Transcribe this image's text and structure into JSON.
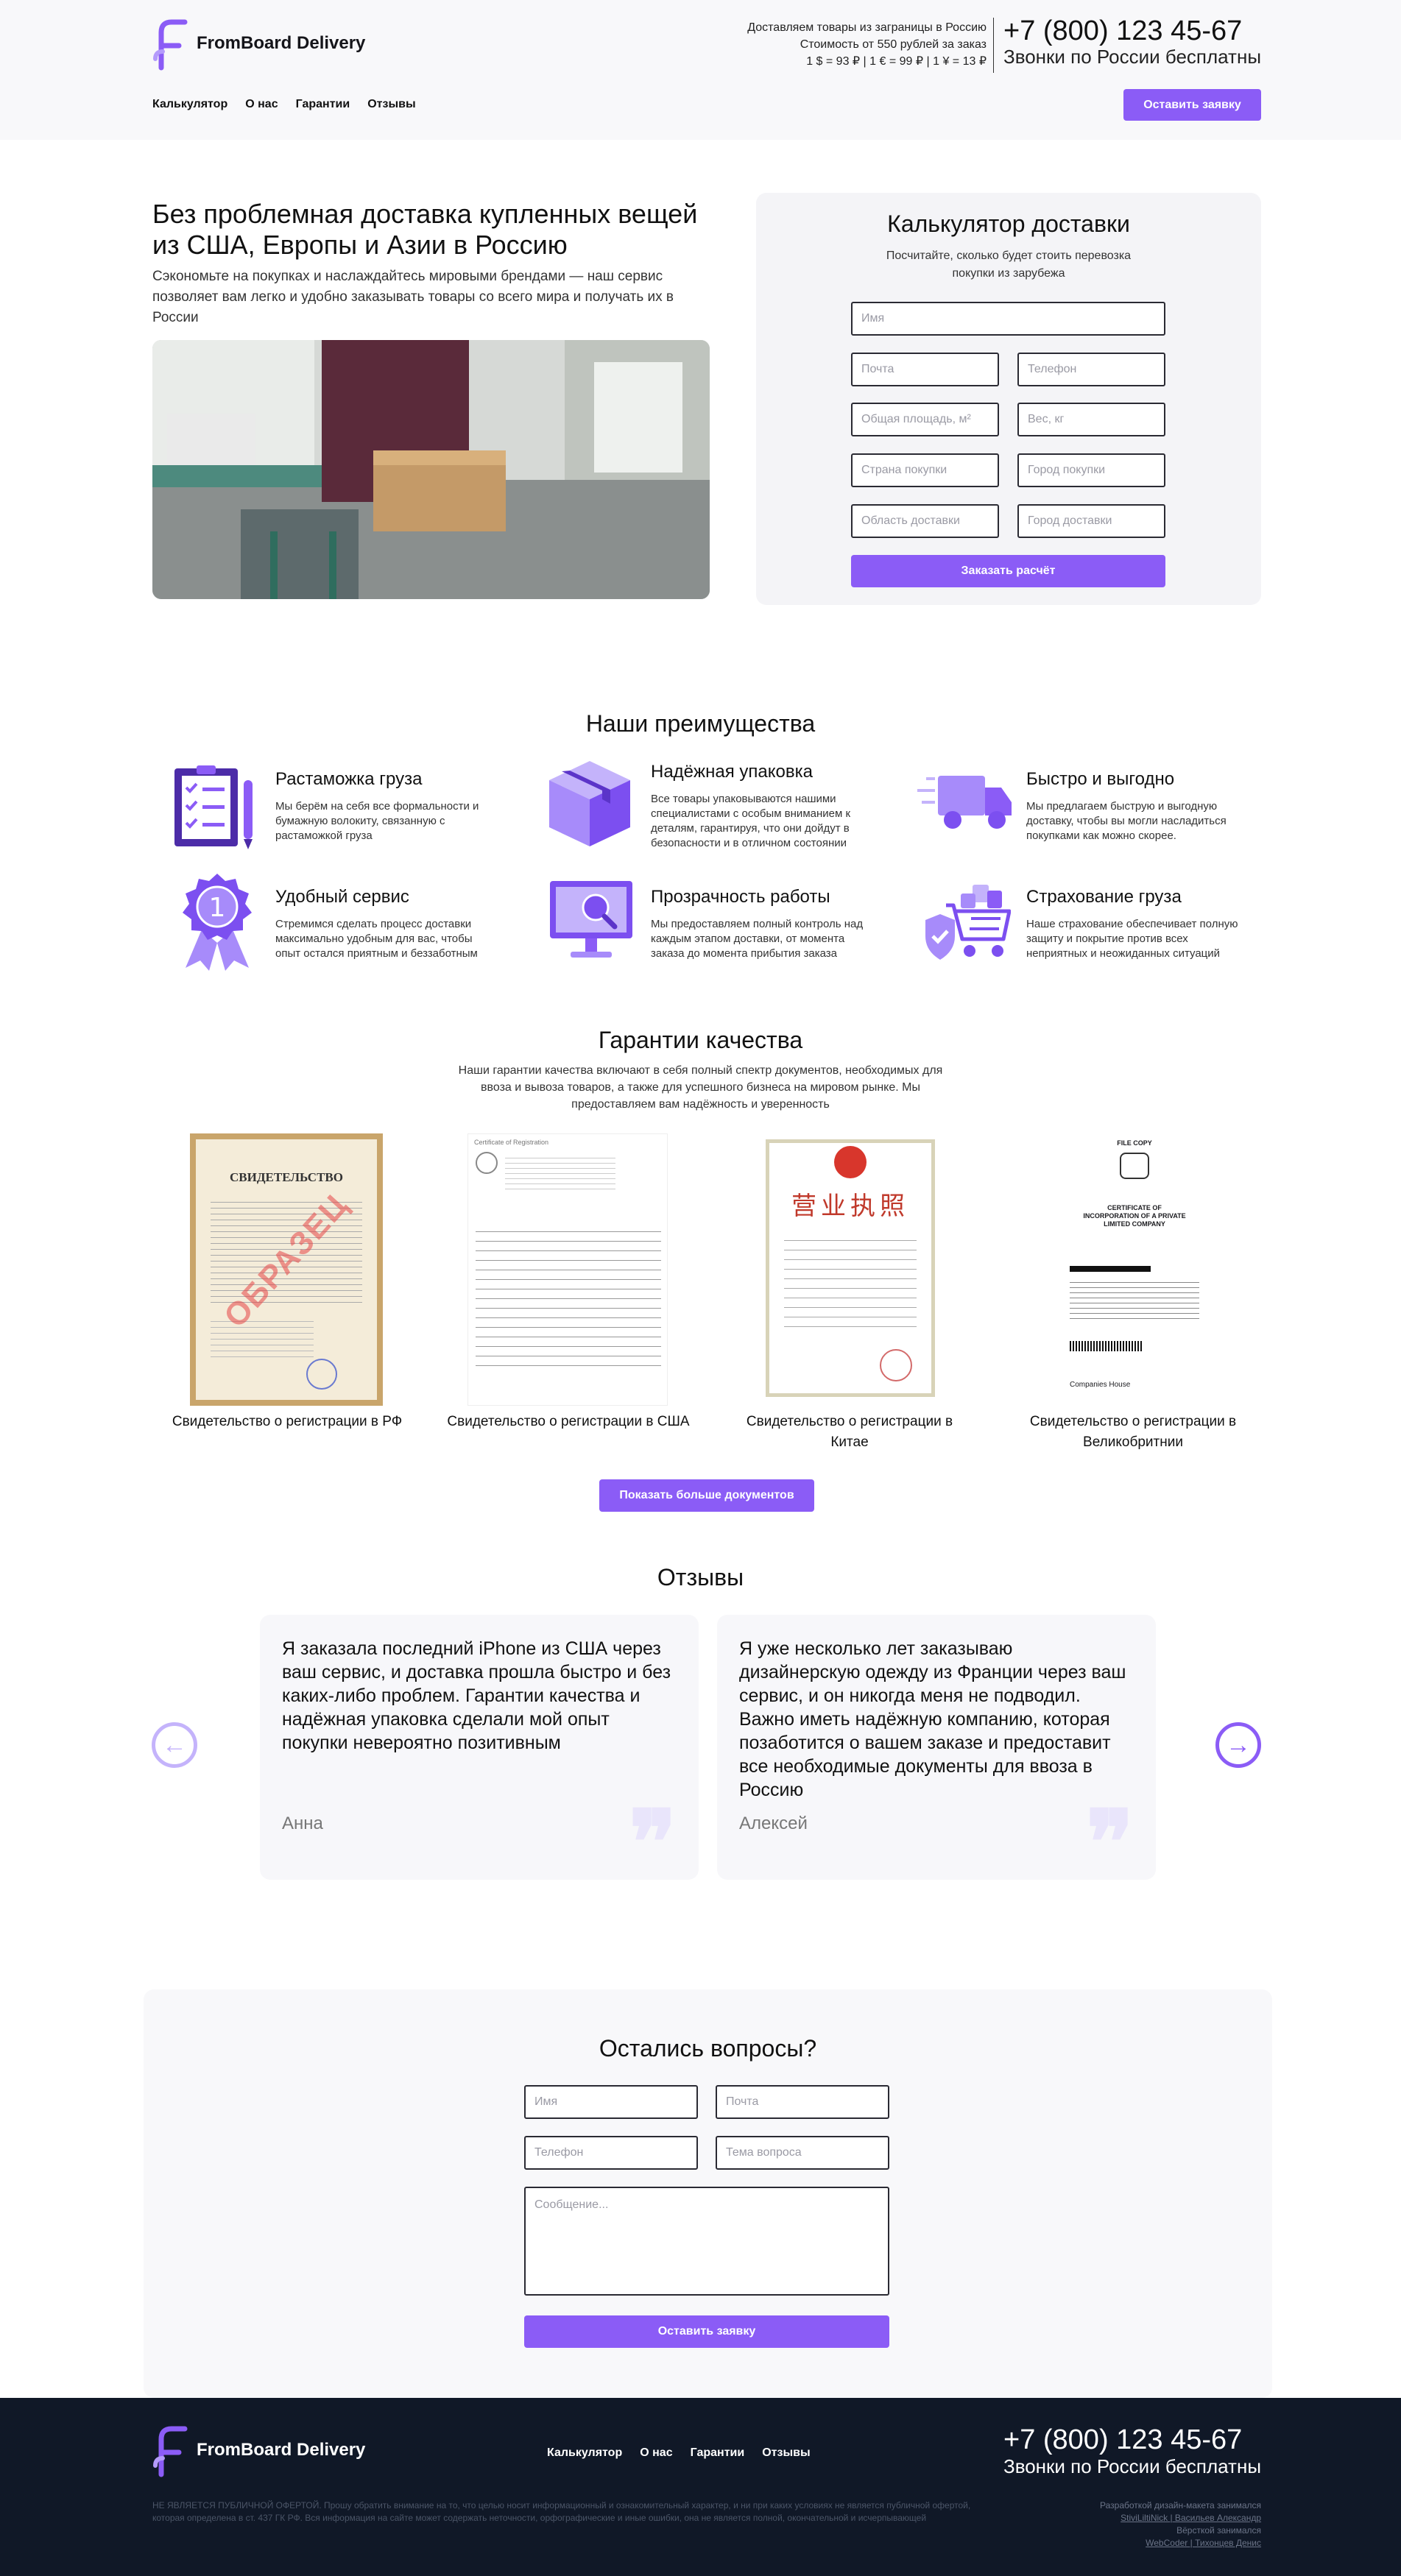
{
  "brand": {
    "name": "FromBoard Delivery",
    "accent": "#8b5cf6"
  },
  "header": {
    "info_lines": [
      "Доставляем товары из заграницы в Россию",
      "Стоимость от 550 рублей за заказ",
      "1 $ = 93 ₽ | 1 € = 99 ₽ | 1 ¥ = 13 ₽"
    ],
    "phone": "+7 (800) 123 45-67",
    "phone_note": "Звонки по России бесплатны",
    "nav": [
      "Калькулятор",
      "О нас",
      "Гарантии",
      "Отзывы"
    ],
    "cta": "Оставить заявку"
  },
  "hero": {
    "title": "Без проблемная доставка купленных вещей из США, Европы и Азии в Россию",
    "subtitle": "Сэкономьте на покупках и наслаждайтесь мировыми брендами — наш сервис позволяет вам легко и удобно заказывать товары со всего мира и получать их в России"
  },
  "calculator": {
    "title": "Калькулятор доставки",
    "subtitle": "Посчитайте, сколько будет стоить перевозка покупки из зарубежа",
    "fields": {
      "name": "Имя",
      "email": "Почта",
      "phone": "Телефон",
      "area": "Общая площадь, м²",
      "weight": "Вес, кг",
      "country": "Страна покупки",
      "city": "Город покупки",
      "region": "Область доставки",
      "dest_city": "Город доставки"
    },
    "submit": "Заказать расчёт"
  },
  "advantages": {
    "title": "Наши преимущества",
    "items": [
      {
        "icon": "checklist-icon",
        "title": "Растаможка груза",
        "text": "Мы берём на себя все формальности и бумажную волокиту, связанную с растаможкой груза"
      },
      {
        "icon": "box-icon",
        "title": "Надёжная упаковка",
        "text": "Все товары упаковываются нашими специалистами с особым вниманием к деталям, гарантируя, что они дойдут в безопасности и в отличном состоянии"
      },
      {
        "icon": "truck-icon",
        "title": "Быстро и выгодно",
        "text": "Мы предлагаем быструю и выгодную доставку, чтобы вы могли насладиться покупками как можно скорее."
      },
      {
        "icon": "medal-icon",
        "title": "Удобный сервис",
        "text": "Стремимся сделать процесс доставки максимально удобным для вас, чтобы опыт остался приятным и беззаботным"
      },
      {
        "icon": "monitor-search-icon",
        "title": "Прозрачность работы",
        "text": "Мы предоставляем полный контроль над каждым этапом доставки, от момента заказа до момента прибытия заказа"
      },
      {
        "icon": "shield-cart-icon",
        "title": "Страхование груза",
        "text": "Наше страхование обеспечивает полную защиту и покрытие против всех неприятных и неожиданных ситуаций"
      }
    ]
  },
  "guarantees": {
    "title": "Гарантии качества",
    "text": "Наши гарантии качества включают в себя полный спектр документов, необходимых для ввоза и вывоза товаров, а также для успешного бизнеса на мировом рынке. Мы предоставляем вам надёжность и уверенность",
    "docs": [
      {
        "caption": "Свидетельство о регистрации в РФ",
        "heading": "СВИДЕТЕЛЬСТВО",
        "stamp": "ОБРАЗЕЦ"
      },
      {
        "caption": "Свидетельство о регистрации в США",
        "heading": "Certificate of Registration"
      },
      {
        "caption": "Свидетельство о регистрации в Китае",
        "heading": "营业执照"
      },
      {
        "caption": "Свидетельство о регистрации в Великобритнии",
        "heading": "CERTIFICATE OF INCORPORATION OF A PRIVATE LIMITED COMPANY",
        "top": "FILE COPY",
        "footer": "Companies House"
      }
    ],
    "more_button": "Показать больше документов"
  },
  "reviews": {
    "title": "Отзывы",
    "items": [
      {
        "text": "Я заказала последний iPhone из США через ваш сервис, и доставка прошла быстро и без каких-либо проблем. Гарантии качества и надёжная упаковка сделали мой опыт покупки невероятно позитивным",
        "author": "Анна"
      },
      {
        "text": "Я уже несколько лет заказываю дизайнерскую одежду из Франции через ваш сервис, и он никогда меня не подводил. Важно иметь надёжную компанию, которая позаботится о вашем заказе и предоставит все необходимые документы для ввоза в Россию",
        "author": "Алексей"
      }
    ],
    "prev": "←",
    "next": "→",
    "quote_mark": "❞"
  },
  "questions": {
    "title": "Остались вопросы?",
    "fields": {
      "name": "Имя",
      "email": "Почта",
      "phone": "Телефон",
      "topic": "Тема вопроса",
      "message": "Сообщение..."
    },
    "submit": "Оставить заявку"
  },
  "footer": {
    "nav": [
      "Калькулятор",
      "О нас",
      "Гарантии",
      "Отзывы"
    ],
    "phone": "+7 (800) 123 45-67",
    "phone_note": "Звонки по России бесплатны",
    "legal": "НЕ ЯВЛЯЕТСЯ ПУБЛИЧНОЙ ОФЕРТОЙ. Прошу обратить внимание на то, что целью носит информационный и ознакомительный характер, и ни при каких условиях не является публичной офертой, которая определена в ст. 437 ГК РФ. Вся информация на сайте может содержать неточности, орфографические и иные ошибки, она не является полной, окончательной и исчерпывающей",
    "credits": [
      "Разработкой дизайн-макета занимался",
      "StiviLiltiNick | Васильев Александр",
      "Вёрсткой занимался",
      "WebCoder | Тихонцев Денис"
    ]
  }
}
